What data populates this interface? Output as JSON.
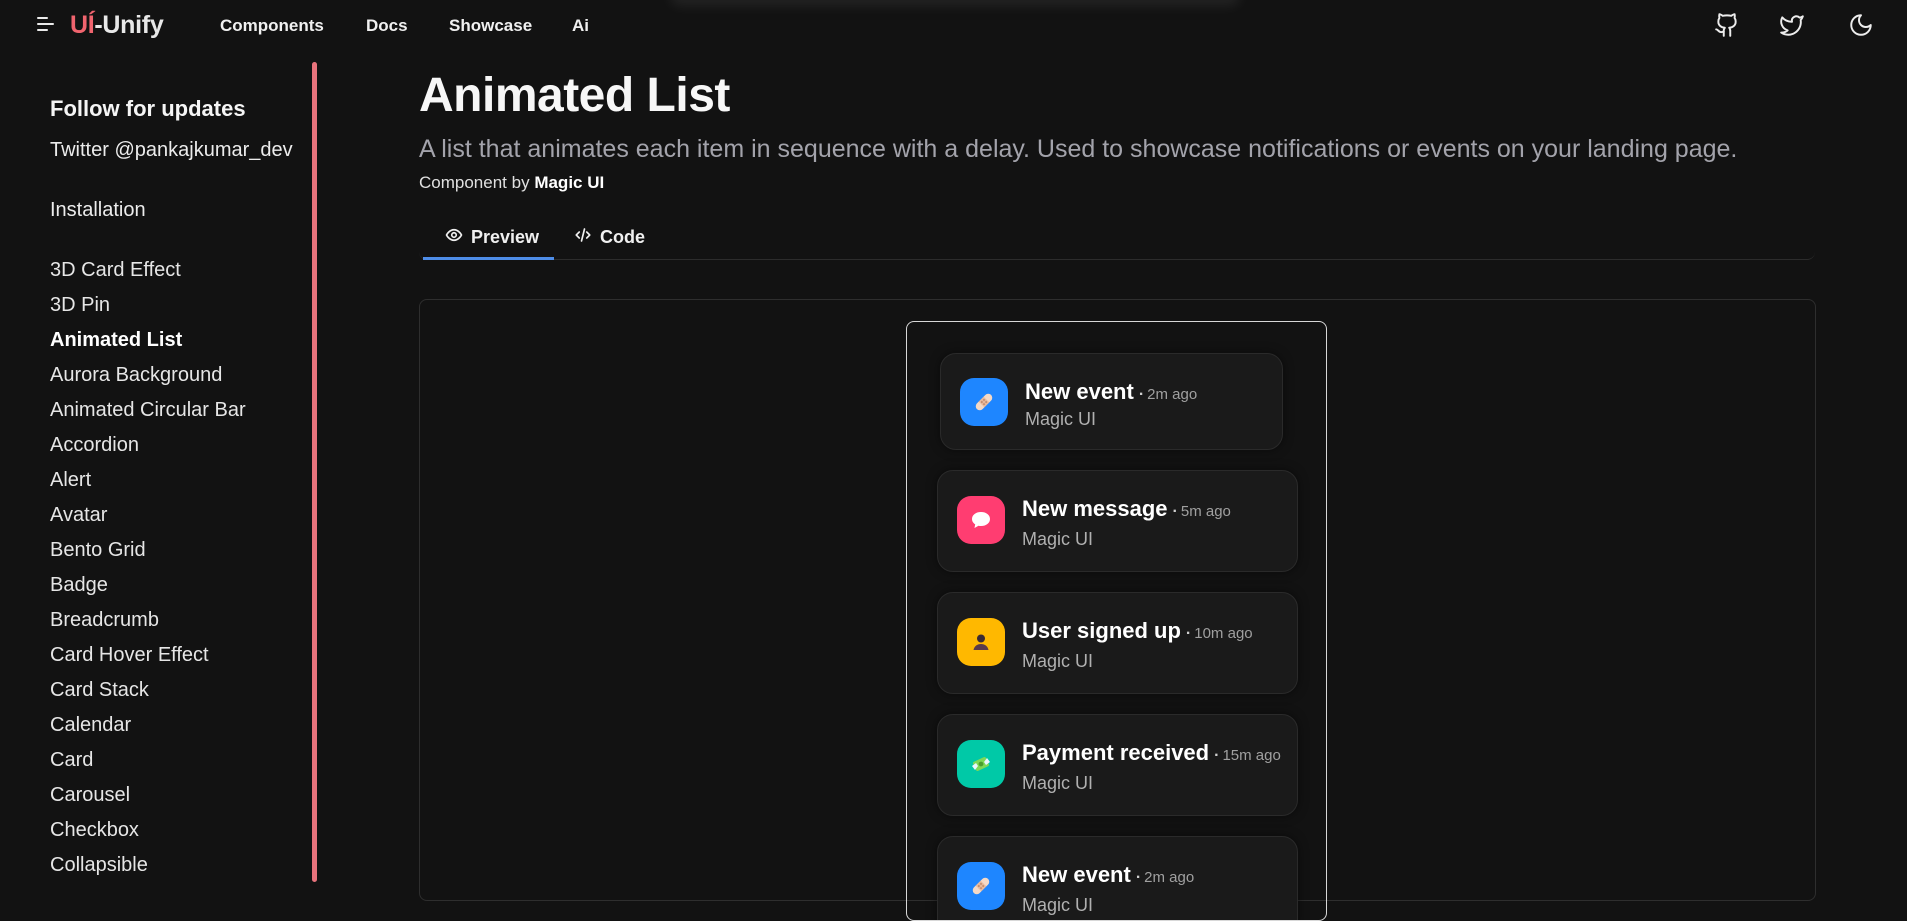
{
  "header": {
    "logo_accent": "UÍ",
    "logo_rest": "-Unify",
    "nav": [
      "Components",
      "Docs",
      "Showcase",
      "Ai"
    ],
    "icons": [
      "github-icon",
      "twitter-icon",
      "moon-icon"
    ]
  },
  "sidebar": {
    "heading": "Follow for updates",
    "twitter": "Twitter @pankajkumar_dev",
    "installation": "Installation",
    "items": [
      "3D Card Effect",
      "3D Pin",
      "Animated List",
      "Aurora Background",
      "Animated Circular Bar",
      "Accordion",
      "Alert",
      "Avatar",
      "Bento Grid",
      "Badge",
      "Breadcrumb",
      "Card Hover Effect",
      "Card Stack",
      "Calendar",
      "Card",
      "Carousel",
      "Checkbox",
      "Collapsible"
    ],
    "active": "Animated List"
  },
  "main": {
    "title": "Animated List",
    "description": "A list that animates each item in sequence with a delay. Used to showcase notifications or events on your landing page.",
    "byline_prefix": "Component by",
    "byline_author": "Magic UI",
    "tabs": [
      {
        "label": "Preview",
        "icon": "eye-icon",
        "active": true
      },
      {
        "label": "Code",
        "icon": "code-icon",
        "active": false
      }
    ]
  },
  "notifications": [
    {
      "title": "New event",
      "time": "2m ago",
      "source": "Magic UI",
      "icon": "bandage-icon",
      "color": "#1e86ff"
    },
    {
      "title": "New message",
      "time": "5m ago",
      "source": "Magic UI",
      "icon": "speech-bubble-icon",
      "color": "#ff3d71"
    },
    {
      "title": "User signed up",
      "time": "10m ago",
      "source": "Magic UI",
      "icon": "person-icon",
      "color": "#ffb800"
    },
    {
      "title": "Payment received",
      "time": "15m ago",
      "source": "Magic UI",
      "icon": "money-icon",
      "color": "#00c9a7"
    },
    {
      "title": "New event",
      "time": "2m ago",
      "source": "Magic UI",
      "icon": "bandage-icon",
      "color": "#1e86ff"
    }
  ],
  "separator": "·"
}
